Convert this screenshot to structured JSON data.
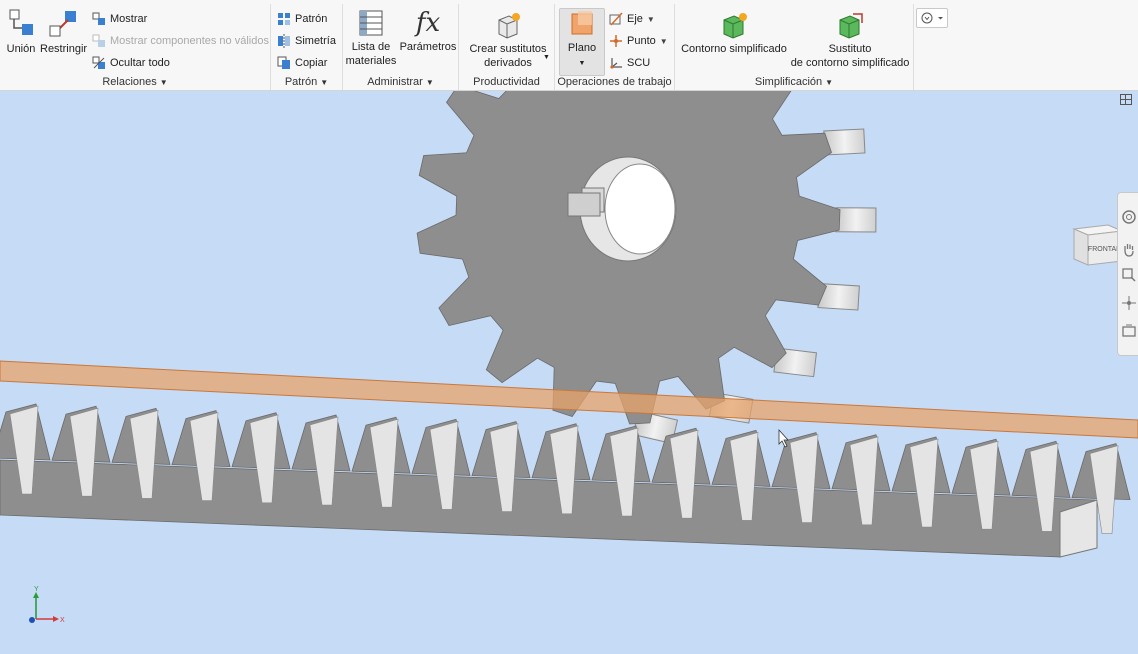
{
  "ribbon": {
    "relaciones": {
      "label": "Relaciones",
      "union": "Unión",
      "restringir": "Restringir",
      "mostrar": "Mostrar",
      "mostrar_no_validos": "Mostrar componentes no válidos",
      "ocultar_todo": "Ocultar todo"
    },
    "patron": {
      "label": "Patrón",
      "patron": "Patrón",
      "simetria": "Simetría",
      "copiar": "Copiar"
    },
    "administrar": {
      "label": "Administrar",
      "lista_line1": "Lista de",
      "lista_line2": "materiales",
      "parametros": "Parámetros",
      "fx_symbol": "fx"
    },
    "productividad": {
      "label": "Productividad",
      "crear_line1": "Crear sustitutos",
      "crear_line2": "derivados"
    },
    "operaciones": {
      "label": "Operaciones de trabajo",
      "plano": "Plano",
      "eje": "Eje",
      "punto": "Punto",
      "scu": "SCU"
    },
    "simplificacion": {
      "label": "Simplificación",
      "contorno": "Contorno simplificado",
      "sustituto_line1": "Sustituto",
      "sustituto_line2": "de contorno simplificado"
    }
  },
  "viewport": {
    "viewcube_face": "FRONTAL",
    "axis_x": "X",
    "axis_y": "Y",
    "background_color": "#c6dbf6",
    "part_color": "#8e8e8e",
    "plane_color": "#e7a36a"
  }
}
